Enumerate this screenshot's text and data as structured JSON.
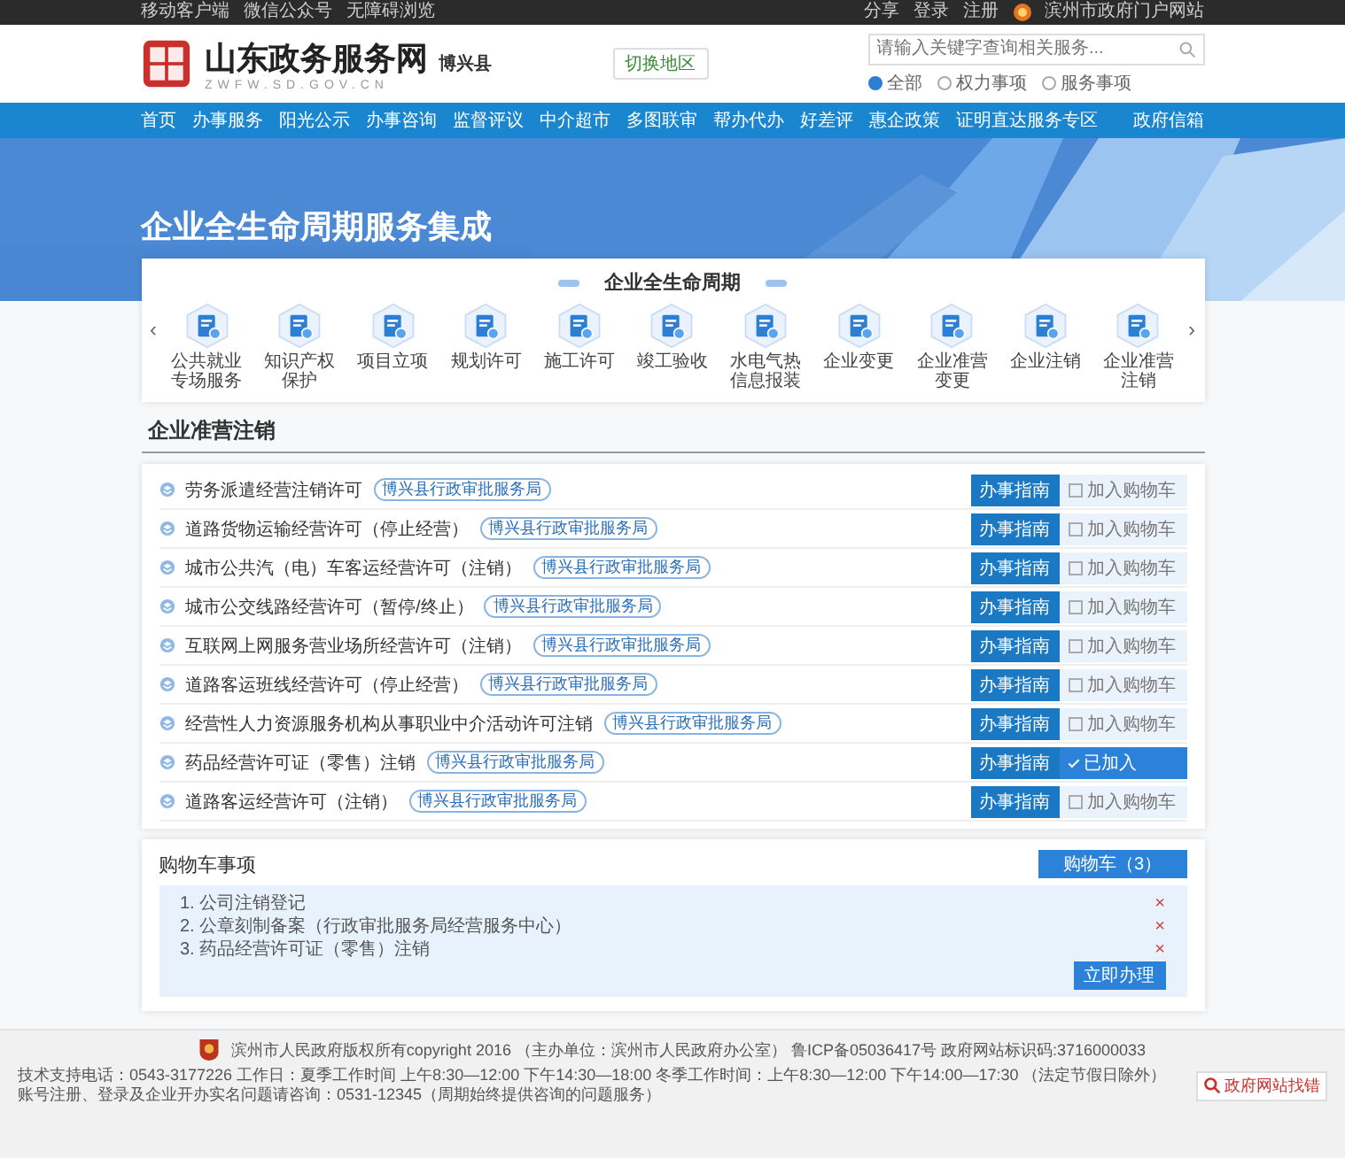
{
  "top_bar": {
    "left": [
      "移动客户端",
      "微信公众号",
      "无障碍浏览"
    ],
    "share": "分享",
    "login": "登录",
    "register": "注册",
    "portal": "滨州市政府门户网站"
  },
  "header": {
    "site_title": "山东政务服务网",
    "site_url": "ZWFW.SD.GOV.CN",
    "region": "博兴县",
    "switch_region": "切换地区",
    "search": {
      "placeholder": "请输入关键字查询相关服务..."
    },
    "scopes": [
      {
        "label": "全部",
        "selected": true
      },
      {
        "label": "权力事项",
        "selected": false
      },
      {
        "label": "服务事项",
        "selected": false
      }
    ]
  },
  "nav": {
    "items": [
      "首页",
      "办事服务",
      "阳光公示",
      "办事咨询",
      "监督评议",
      "中介超市",
      "多图联审",
      "帮办代办",
      "好差评",
      "惠企政策",
      "证明直达服务专区"
    ],
    "right": "政府信箱"
  },
  "banner": {
    "title": "企业全生命周期服务集成"
  },
  "lifecycle": {
    "title": "企业全生命周期",
    "prev": "‹",
    "next": "›",
    "stages": [
      {
        "label": "公共就业专场服务"
      },
      {
        "label": "知识产权保护"
      },
      {
        "label": "项目立项"
      },
      {
        "label": "规划许可"
      },
      {
        "label": "施工许可"
      },
      {
        "label": "竣工验收"
      },
      {
        "label": "水电气热信息报装"
      },
      {
        "label": "企业变更"
      },
      {
        "label": "企业准营变更"
      },
      {
        "label": "企业注销"
      },
      {
        "label": "企业准营注销"
      }
    ]
  },
  "section_title": "企业准营注销",
  "rows": [
    {
      "name": "劳务派遣经营注销许可",
      "department": "博兴县行政审批服务局",
      "guide": "办事指南",
      "cart": "加入购物车",
      "added": false
    },
    {
      "name": "道路货物运输经营许可（停止经营）",
      "department": "博兴县行政审批服务局",
      "guide": "办事指南",
      "cart": "加入购物车",
      "added": false
    },
    {
      "name": "城市公共汽（电）车客运经营许可（注销）",
      "department": "博兴县行政审批服务局",
      "guide": "办事指南",
      "cart": "加入购物车",
      "added": false
    },
    {
      "name": "城市公交线路经营许可（暂停/终止）",
      "department": "博兴县行政审批服务局",
      "guide": "办事指南",
      "cart": "加入购物车",
      "added": false
    },
    {
      "name": "互联网上网服务营业场所经营许可（注销）",
      "department": "博兴县行政审批服务局",
      "guide": "办事指南",
      "cart": "加入购物车",
      "added": false
    },
    {
      "name": "道路客运班线经营许可（停止经营）",
      "department": "博兴县行政审批服务局",
      "guide": "办事指南",
      "cart": "加入购物车",
      "added": false
    },
    {
      "name": "经营性人力资源服务机构从事职业中介活动许可注销",
      "department": "博兴县行政审批服务局",
      "guide": "办事指南",
      "cart": "加入购物车",
      "added": false
    },
    {
      "name": "药品经营许可证（零售）注销",
      "department": "博兴县行政审批服务局",
      "guide": "办事指南",
      "cart": "已加入",
      "added": true
    },
    {
      "name": "道路客运经营许可（注销）",
      "department": "博兴县行政审批服务局",
      "guide": "办事指南",
      "cart": "加入购物车",
      "added": false
    }
  ],
  "cart": {
    "title": "购物车事项",
    "count_button": "购物车（3）",
    "remove": "×",
    "items": [
      "1. 公司注销登记",
      "2. 公章刻制备案（行政审批服务局经营服务中心）",
      "3. 药品经营许可证（零售）注销"
    ],
    "submit": "立即办理"
  },
  "footer": {
    "line1": "滨州市人民政府版权所有copyright 2016 （主办单位：滨州市人民政府办公室） 鲁ICP备05036417号 政府网站标识码:3716000033",
    "line2": [
      "技术支持电话：0543-3177226 工作日：夏季工作时间 上午8:30—12:00 下午14:30—18:00 冬季工作时间：上午8:30—12:00 下午14:00—17:30 （法定节假日除外）",
      "账号注册、登录及企业开办实名问题请咨询：0531-12345（周期始终提供咨询的问题服务）"
    ],
    "badge": "政府网站找错"
  }
}
